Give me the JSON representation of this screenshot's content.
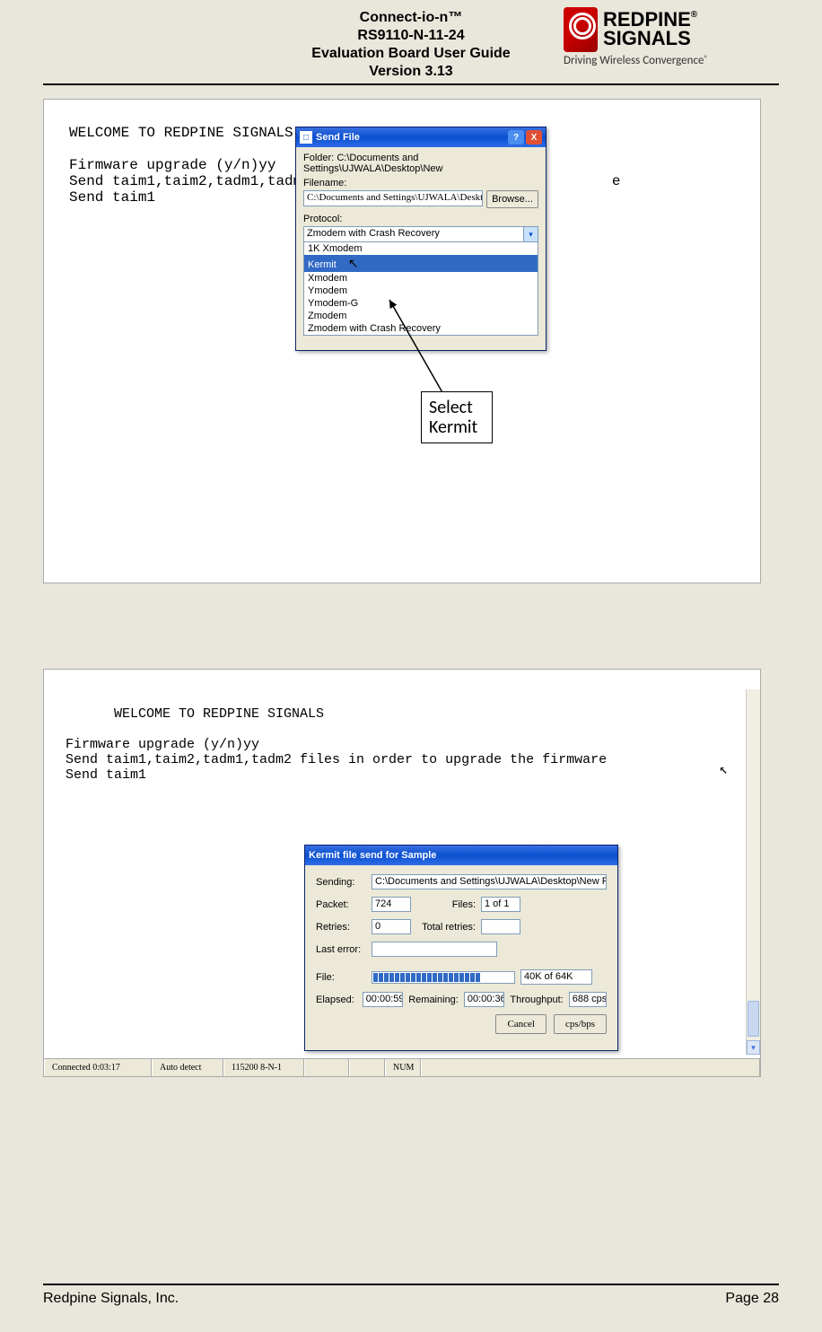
{
  "header": {
    "line1": "Connect-io-n™",
    "line2": "RS9110-N-11-24",
    "line3": "Evaluation Board User Guide",
    "line4": "Version 3.13"
  },
  "logo": {
    "brand1": "REDPINE",
    "brand2": "SIGNALS",
    "reg": "®",
    "tagline": "Driving Wireless Convergence"
  },
  "screenshot1": {
    "terminal_text": "WELCOME TO REDPINE SIGNALS\n\nFirmware upgrade (y/n)yy\nSend taim1,taim2,tadm1,tadm2 fi                                e\nSend taim1",
    "dialog": {
      "title": "Send File",
      "folder_label": "Folder:",
      "folder_value": "C:\\Documents and Settings\\UJWALA\\Desktop\\New",
      "filename_label": "Filename:",
      "filename_value": "C:\\Documents and Settings\\UJWALA\\Desktop\\",
      "browse_label": "Browse...",
      "protocol_label": "Protocol:",
      "protocol_value": "Zmodem with Crash Recovery",
      "options": [
        "1K Xmodem",
        "Kermit",
        "Xmodem",
        "Ymodem",
        "Ymodem-G",
        "Zmodem",
        "Zmodem with Crash Recovery"
      ],
      "help_icon": "?",
      "close_icon": "X"
    },
    "callout": "Select Kermit"
  },
  "screenshot2": {
    "terminal_text": "WELCOME TO REDPINE SIGNALS\n\nFirmware upgrade (y/n)yy\nSend taim1,taim2,tadm1,tadm2 files in order to upgrade the firmware\nSend taim1",
    "dialog": {
      "title": "Kermit file send for Sample",
      "sending_label": "Sending:",
      "sending_value": "C:\\Documents and Settings\\UJWALA\\Desktop\\New Folder\\DTOP_ALL\\t",
      "packet_label": "Packet:",
      "packet_value": "724",
      "files_label": "Files:",
      "files_value": "1 of 1",
      "retries_label": "Retries:",
      "retries_value": "0",
      "total_retries_label": "Total retries:",
      "total_retries_value": "",
      "last_error_label": "Last error:",
      "last_error_value": "",
      "file_label": "File:",
      "file_progress_text": "40K of 64K",
      "elapsed_label": "Elapsed:",
      "elapsed_value": "00:00:59",
      "remaining_label": "Remaining:",
      "remaining_value": "00:00:36",
      "throughput_label": "Throughput:",
      "throughput_value": "688 cps",
      "cancel_label": "Cancel",
      "cpsbps_label": "cps/bps"
    },
    "statusbar": {
      "connected": "Connected 0:03:17",
      "detect": "Auto detect",
      "baud": "115200 8-N-1",
      "num": "NUM"
    }
  },
  "footer": {
    "company": "Redpine Signals, Inc.",
    "page": "Page 28"
  }
}
